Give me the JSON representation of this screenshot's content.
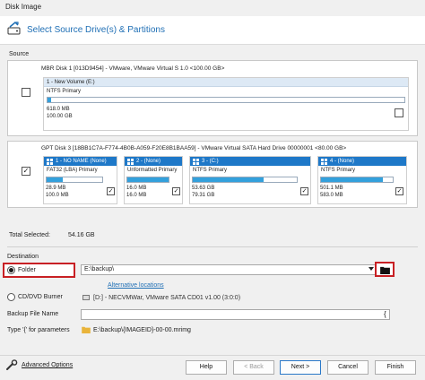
{
  "window": {
    "title": "Disk Image"
  },
  "header": {
    "title": "Select Source Drive(s) & Partitions"
  },
  "source": {
    "label": "Source",
    "disk1": {
      "title": "MBR Disk 1 [013D9454] - VMware,  VMware Virtual S 1.0  <100.00 GB>",
      "checked": false,
      "partition": {
        "name": "1 - New Volume (E:)",
        "fs": "NTFS Primary",
        "used": "618.0 MB",
        "total": "100.00 GB",
        "fill": 0.01,
        "checked": false
      }
    },
    "disk2": {
      "title": "GPT Disk 3 [18BB1C7A-F774-4B0B-A059-F20E8B1BAA59] - VMware Virtual SATA Hard Drive 00000001  <80.00 GB>",
      "checked": true,
      "partitions": [
        {
          "name": "1 - NO NAME (None)",
          "fs": "FAT32 (LBA) Primary",
          "used": "28.9 MB",
          "total": "100.0 MB",
          "fill": 0.29,
          "checked": true
        },
        {
          "name": "2 - (None)",
          "fs": "Unformatted Primary",
          "used": "16.0 MB",
          "total": "16.0 MB",
          "fill": 1.0,
          "checked": true
        },
        {
          "name": "3 - (C:)",
          "fs": "NTFS Primary",
          "used": "53.63 GB",
          "total": "79.31 GB",
          "fill": 0.68,
          "checked": true
        },
        {
          "name": "4 - (None)",
          "fs": "NTFS Primary",
          "used": "501.1 MB",
          "total": "583.0 MB",
          "fill": 0.86,
          "checked": true
        }
      ]
    }
  },
  "total": {
    "label": "Total Selected:",
    "value": "54.16 GB"
  },
  "destination": {
    "label": "Destination",
    "folder_label": "Folder",
    "folder_value": "E:\\backup\\",
    "alt_locations": "Alternative locations",
    "cd_label": "CD/DVD Burner",
    "cd_value": "[D:] - NECVMWar, VMware SATA CD01 v1.00 (3:0:0)",
    "backup_name_label": "Backup File Name",
    "backup_name_value": "",
    "brace": "{",
    "type_hint": "Type '{' for parameters",
    "preview": "E:\\backup\\{IMAGEID}-00-00.mrimg"
  },
  "footer": {
    "advanced": "Advanced Options",
    "help": "Help",
    "back": "< Back",
    "next": "Next >",
    "cancel": "Cancel",
    "finish": "Finish"
  },
  "colors": {
    "accent": "#1e78c8",
    "highlight": "#c82024"
  }
}
